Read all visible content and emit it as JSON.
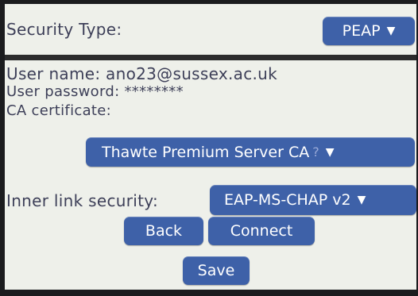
{
  "security_type": {
    "label": "Security Type:",
    "value": "PEAP",
    "caret": "▼"
  },
  "fields": {
    "username_line": "User name: ano23@sussex.ac.uk",
    "password_line": "User password: ********",
    "ca_label": "CA certificate:"
  },
  "ca_select": {
    "value": "Thawte Premium Server CA",
    "hint": "?",
    "caret": "▼"
  },
  "inner_link": {
    "label": "Inner link security:",
    "value": "EAP-MS-CHAP v2",
    "caret": "▼"
  },
  "buttons": {
    "back": "Back",
    "connect": "Connect",
    "save": "Save"
  },
  "colors": {
    "button": "#3e61a8",
    "screen_bg": "#eef0ea",
    "text": "#3d3f58"
  }
}
